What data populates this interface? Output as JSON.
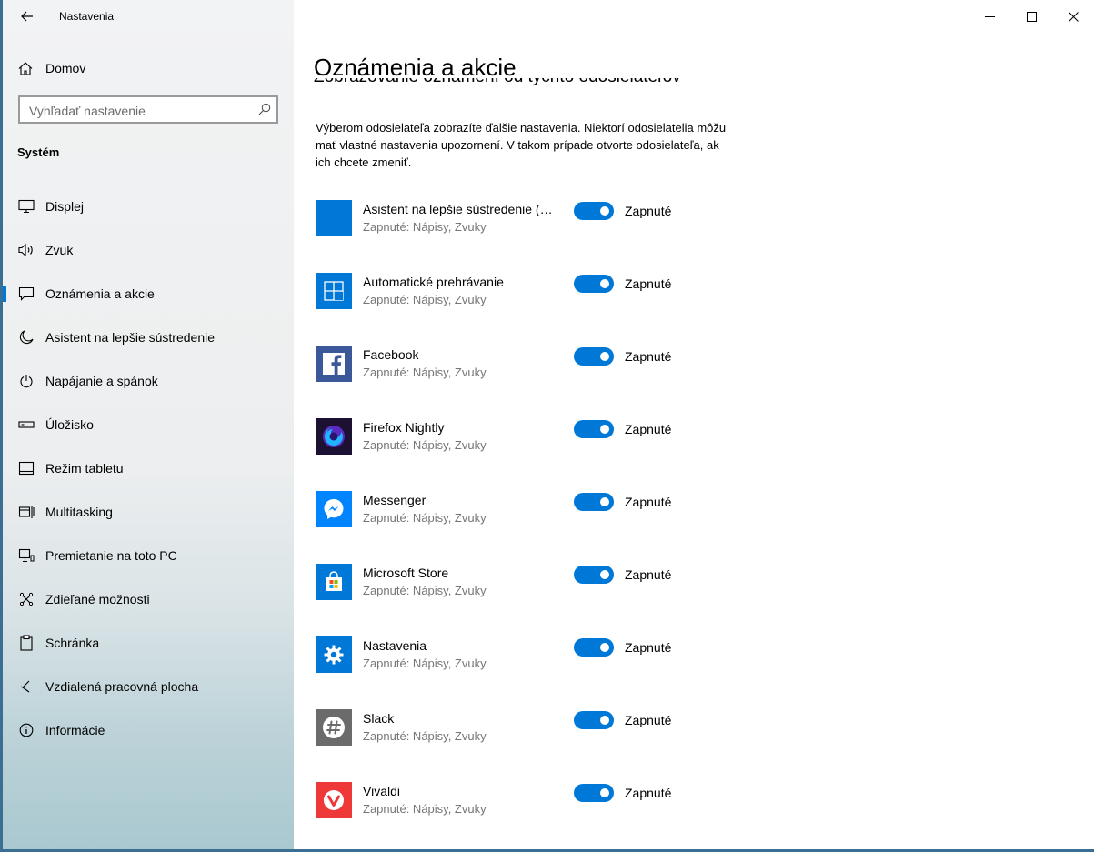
{
  "window": {
    "title": "Nastavenia",
    "minimize_icon": "minimize-icon",
    "maximize_icon": "maximize-icon",
    "close_icon": "close-icon"
  },
  "nav": {
    "home_label": "Domov",
    "search_placeholder": "Vyhľadať nastavenie",
    "section_label": "Systém",
    "items": [
      {
        "label": "Displej",
        "icon": "display-icon",
        "selected": false
      },
      {
        "label": "Zvuk",
        "icon": "speaker-icon",
        "selected": false
      },
      {
        "label": "Oznámenia a akcie",
        "icon": "notification-icon",
        "selected": true
      },
      {
        "label": "Asistent na lepšie sústredenie",
        "icon": "moon-icon",
        "selected": false
      },
      {
        "label": "Napájanie a spánok",
        "icon": "power-icon",
        "selected": false
      },
      {
        "label": "Úložisko",
        "icon": "storage-icon",
        "selected": false
      },
      {
        "label": "Režim tabletu",
        "icon": "tablet-icon",
        "selected": false
      },
      {
        "label": "Multitasking",
        "icon": "multitasking-icon",
        "selected": false
      },
      {
        "label": "Premietanie na toto PC",
        "icon": "projecting-icon",
        "selected": false
      },
      {
        "label": "Zdieľané možnosti",
        "icon": "shared-icon",
        "selected": false
      },
      {
        "label": "Schránka",
        "icon": "clipboard-icon",
        "selected": false
      },
      {
        "label": "Vzdialená pracovná plocha",
        "icon": "remote-desktop-icon",
        "selected": false
      },
      {
        "label": "Informácie",
        "icon": "info-icon",
        "selected": false
      }
    ]
  },
  "main": {
    "title": "Oznámenia a akcie",
    "section_header": "Zobrazovanie oznámení od týchto odosielateľov",
    "description": "Výberom odosielateľa zobrazíte ďalšie nastavenia. Niektorí odosielatelia môžu mať vlastné nastavenia upozornení. V takom prípade otvorte odosielateľa, ak ich chcete zmeniť.",
    "senders": [
      {
        "name": "Asistent na lepšie sústredenie (pr...",
        "status": "Zapnuté: Nápisy, Zvuky",
        "toggle_label": "Zapnuté",
        "on": true,
        "icon": "focus-assist-app-icon",
        "color": "#0078d7"
      },
      {
        "name": "Automatické prehrávanie",
        "status": "Zapnuté: Nápisy, Zvuky",
        "toggle_label": "Zapnuté",
        "on": true,
        "icon": "autoplay-app-icon",
        "color": "#0078d7"
      },
      {
        "name": "Facebook",
        "status": "Zapnuté: Nápisy, Zvuky",
        "toggle_label": "Zapnuté",
        "on": true,
        "icon": "facebook-app-icon",
        "color": "#3b5998"
      },
      {
        "name": "Firefox Nightly",
        "status": "Zapnuté: Nápisy, Zvuky",
        "toggle_label": "Zapnuté",
        "on": true,
        "icon": "firefox-nightly-app-icon",
        "color": "#1d1133"
      },
      {
        "name": "Messenger",
        "status": "Zapnuté: Nápisy, Zvuky",
        "toggle_label": "Zapnuté",
        "on": true,
        "icon": "messenger-app-icon",
        "color": "#0084ff"
      },
      {
        "name": "Microsoft Store",
        "status": "Zapnuté: Nápisy, Zvuky",
        "toggle_label": "Zapnuté",
        "on": true,
        "icon": "microsoft-store-app-icon",
        "color": "#0078d7"
      },
      {
        "name": "Nastavenia",
        "status": "Zapnuté: Nápisy, Zvuky",
        "toggle_label": "Zapnuté",
        "on": true,
        "icon": "settings-app-icon",
        "color": "#0078d7"
      },
      {
        "name": "Slack",
        "status": "Zapnuté: Nápisy, Zvuky",
        "toggle_label": "Zapnuté",
        "on": true,
        "icon": "slack-app-icon",
        "color": "#6b6b6b"
      },
      {
        "name": "Vivaldi",
        "status": "Zapnuté: Nápisy, Zvuky",
        "toggle_label": "Zapnuté",
        "on": true,
        "icon": "vivaldi-app-icon",
        "color": "#ef3939"
      }
    ]
  },
  "colors": {
    "accent": "#0078d7",
    "secondary_text": "#767676"
  }
}
